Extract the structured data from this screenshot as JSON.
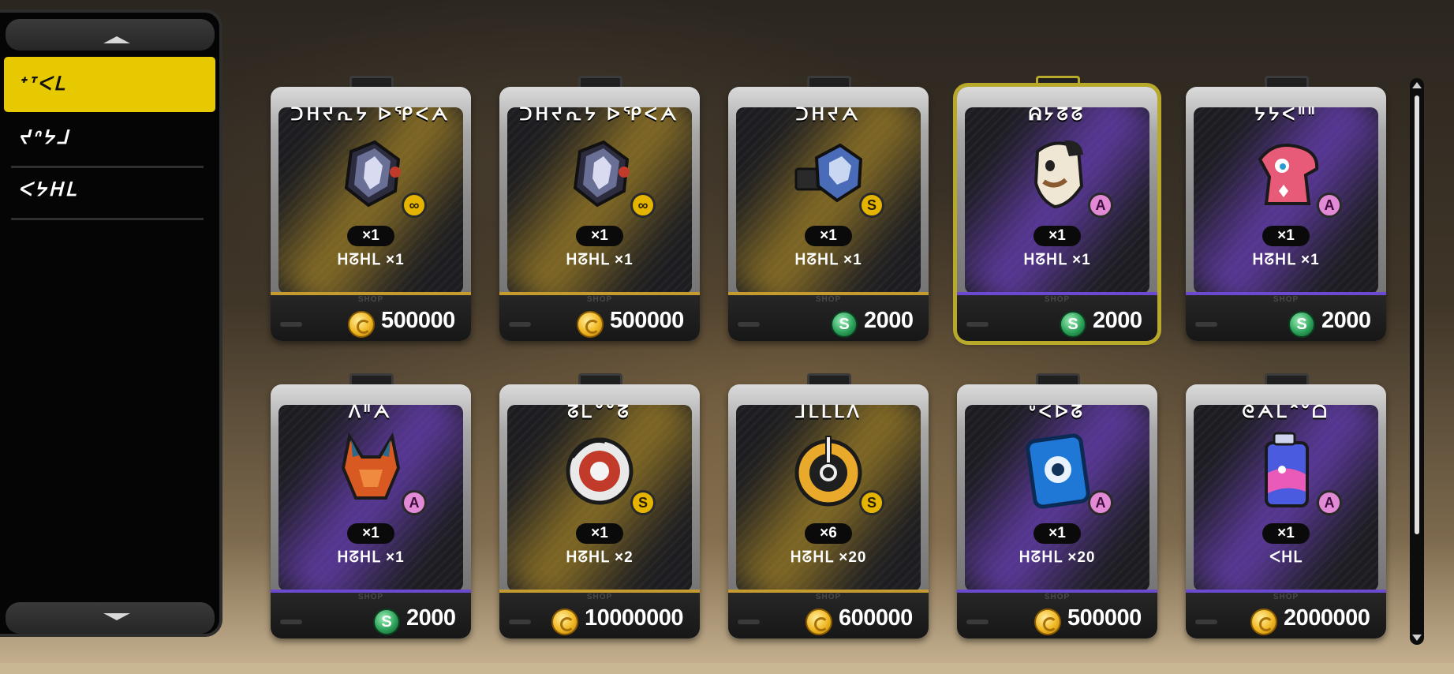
{
  "sidebar": {
    "categories": [
      {
        "label": "ᐩᐪᐸᒪ",
        "selected": true
      },
      {
        "label": "ᔪᐢᔭᒧ",
        "selected": false
      },
      {
        "label": "ᐸᔭᕼᒪ",
        "selected": false
      }
    ]
  },
  "colors": {
    "accent_yellow": "#e6c900",
    "highlight_border": "#b9a92a",
    "gold_glow": "#c9a028",
    "purple_glow": "#7846d2"
  },
  "shop": {
    "shop_label": "SHOP",
    "selected_index": 3,
    "items": [
      {
        "name": "ᑐᕼᔪᕆᔭ ᐅᕿᐸᗅ",
        "icon": "metallic-shell-icon",
        "rarity": "∞",
        "rarity_type": "inf",
        "glow": "gold",
        "qty": "×1",
        "limit": "ᕼᘔᕼᒪ ×1",
        "currency": "coin",
        "price": "500000"
      },
      {
        "name": "ᑐᕼᔪᕆᔭ ᐅᕿᐸᗅ",
        "icon": "metallic-shell-icon",
        "rarity": "∞",
        "rarity_type": "inf",
        "glow": "gold",
        "qty": "×1",
        "limit": "ᕼᘔᕼᒪ ×1",
        "currency": "coin",
        "price": "500000"
      },
      {
        "name": "ᑐᕼᔪᗅ",
        "icon": "wrench-tool-icon",
        "rarity": "S",
        "rarity_type": "S",
        "glow": "gold",
        "qty": "×1",
        "limit": "ᕼᘔᕼᒪ ×1",
        "currency": "gem",
        "price": "2000"
      },
      {
        "name": "ᕱᔭᘔᘔ",
        "icon": "cow-mask-icon",
        "rarity": "A",
        "rarity_type": "A",
        "glow": "purple",
        "qty": "×1",
        "limit": "ᕼᘔᕼᒪ ×1",
        "currency": "gem",
        "price": "2000"
      },
      {
        "name": "ᔭᔭᐸᐦᐦ",
        "icon": "pink-creature-icon",
        "rarity": "A",
        "rarity_type": "A",
        "glow": "purple",
        "qty": "×1",
        "limit": "ᕼᘔᕼᒪ ×1",
        "currency": "gem",
        "price": "2000"
      },
      {
        "name": "ᐱᐦᗅ",
        "icon": "fox-helmet-icon",
        "rarity": "A",
        "rarity_type": "A",
        "glow": "purple",
        "qty": "×1",
        "limit": "ᕼᘔᕼᒪ ×1",
        "currency": "gem",
        "price": "2000"
      },
      {
        "name": "ᘔᒪᐡᐡᘔ",
        "icon": "rescue-disc-icon",
        "rarity": "S",
        "rarity_type": "S",
        "glow": "gold",
        "qty": "×1",
        "limit": "ᕼᘔᕼᒪ ×2",
        "currency": "coin",
        "price": "10000000"
      },
      {
        "name": "ᒧᒪᒪᒪᐱ",
        "icon": "power-core-icon",
        "rarity": "S",
        "rarity_type": "S",
        "glow": "gold",
        "qty": "×6",
        "limit": "ᕼᘔᕼᒪ ×20",
        "currency": "coin",
        "price": "600000"
      },
      {
        "name": "ᐡᐸᐅᘔ",
        "icon": "blue-card-icon",
        "rarity": "A",
        "rarity_type": "A",
        "glow": "purple",
        "qty": "×1",
        "limit": "ᕼᘔᕼᒪ ×20",
        "currency": "coin",
        "price": "500000"
      },
      {
        "name": "ᘓᗅᒪᐢᐡᗝ",
        "icon": "drink-can-icon",
        "rarity": "A",
        "rarity_type": "A",
        "glow": "purple",
        "qty": "×1",
        "limit": "ᐸᕼᒪ",
        "currency": "coin",
        "price": "2000000"
      }
    ]
  }
}
